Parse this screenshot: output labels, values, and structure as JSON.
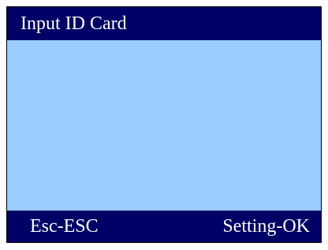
{
  "title_bar": {
    "title": "Input ID Card"
  },
  "softkeys": {
    "left_label": "Esc-ESC",
    "right_label": "Setting-OK"
  },
  "colors": {
    "bar_background": "#000066",
    "content_background": "#99ccff",
    "text": "#ffffff"
  }
}
